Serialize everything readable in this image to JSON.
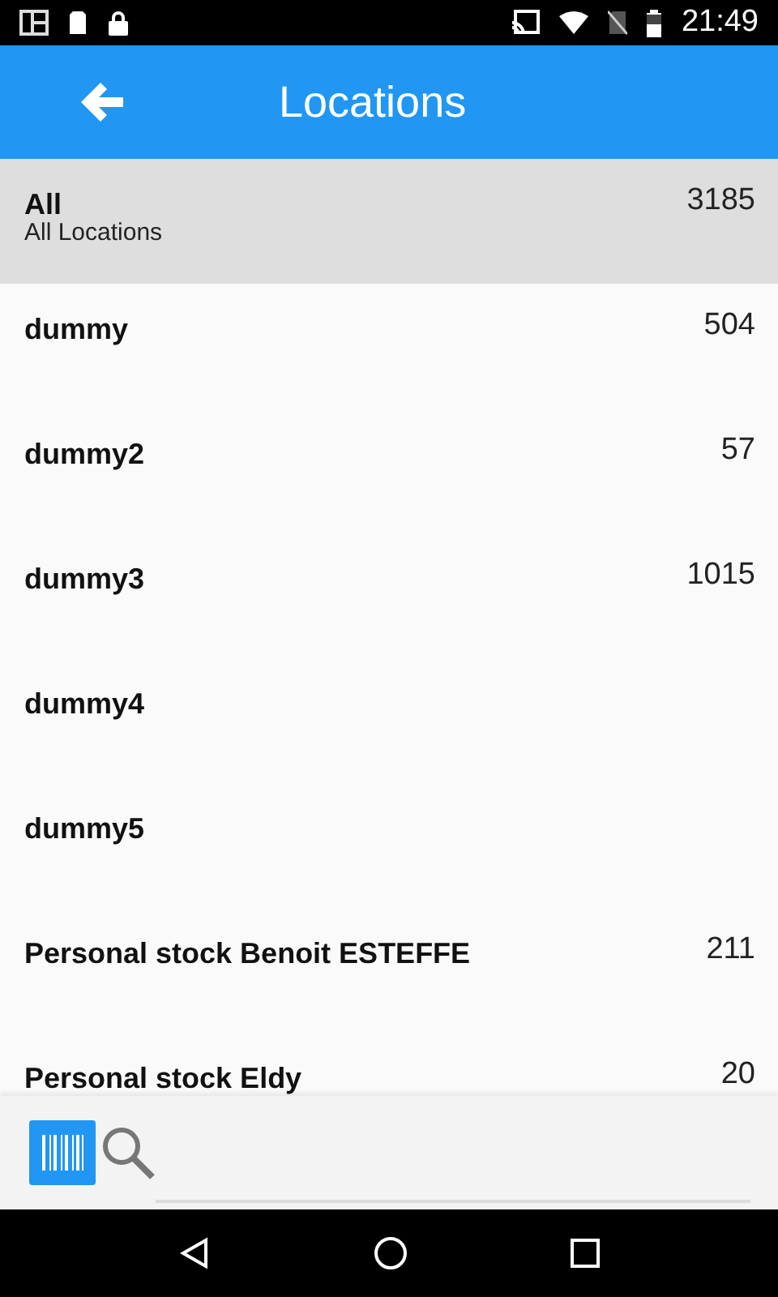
{
  "status_bar": {
    "time": "21:49"
  },
  "app_bar": {
    "title": "Locations"
  },
  "locations": [
    {
      "name": "All",
      "subtitle": "All Locations",
      "count": "3185",
      "selected": true
    },
    {
      "name": "dummy",
      "count": "504",
      "selected": false
    },
    {
      "name": "dummy2",
      "count": "57",
      "selected": false
    },
    {
      "name": "dummy3",
      "count": "1015",
      "selected": false
    },
    {
      "name": "dummy4",
      "selected": false
    },
    {
      "name": "dummy5",
      "selected": false
    },
    {
      "name": "Personal stock Benoit ESTEFFE",
      "count": "211",
      "selected": false
    },
    {
      "name": "Personal stock Eldy",
      "count": "20",
      "selected": false
    }
  ]
}
